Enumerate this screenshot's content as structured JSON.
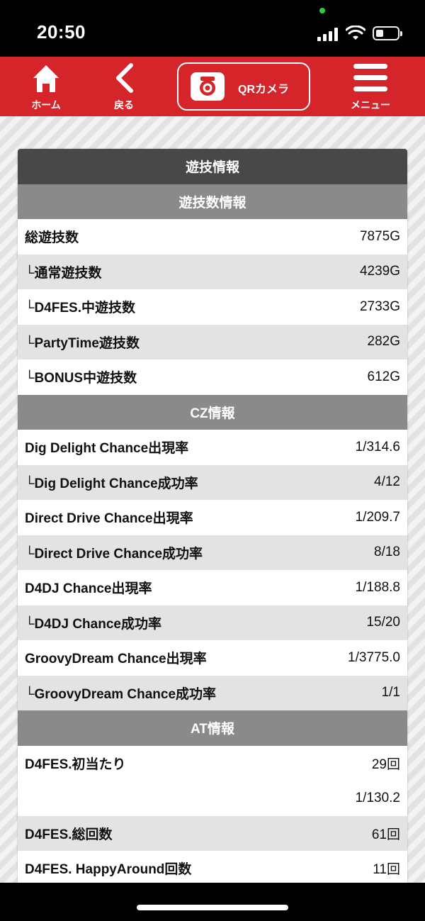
{
  "status_bar": {
    "time": "20:50"
  },
  "nav": {
    "home_label": "ホーム",
    "back_label": "戻る",
    "qr_label": "QRカメラ",
    "menu_label": "メニュー",
    "brand_color": "#d5252a"
  },
  "card": {
    "title": "遊技情報",
    "sections": [
      {
        "header": "遊技数情報"
      },
      {
        "header": "CZ情報"
      },
      {
        "header": "AT情報"
      }
    ],
    "rows": [
      {
        "label": "総遊技数",
        "value": "7875G"
      },
      {
        "label": "└通常遊技数",
        "value": "4239G"
      },
      {
        "label": "└D4FES.中遊技数",
        "value": "2733G"
      },
      {
        "label": "└PartyTime遊技数",
        "value": "282G"
      },
      {
        "label": "└BONUS中遊技数",
        "value": "612G"
      },
      {
        "label": "Dig Delight Chance出現率",
        "value": "1/314.6"
      },
      {
        "label": "└Dig Delight Chance成功率",
        "value": "4/12"
      },
      {
        "label": "Direct Drive Chance出現率",
        "value": "1/209.7"
      },
      {
        "label": "└Direct Drive Chance成功率",
        "value": "8/18"
      },
      {
        "label": "D4DJ Chance出現率",
        "value": "1/188.8"
      },
      {
        "label": "└D4DJ Chance成功率",
        "value": "15/20"
      },
      {
        "label": "GroovyDream Chance出現率",
        "value": "1/3775.0"
      },
      {
        "label": "└GroovyDream Chance成功率",
        "value": "1/1"
      },
      {
        "label": "D4FES.初当たり",
        "value": "29回"
      },
      {
        "label": "",
        "value": "1/130.2"
      },
      {
        "label": "D4FES.総回数",
        "value": "61回"
      },
      {
        "label": "D4FES. HappyAround回数",
        "value": "11回"
      }
    ]
  }
}
